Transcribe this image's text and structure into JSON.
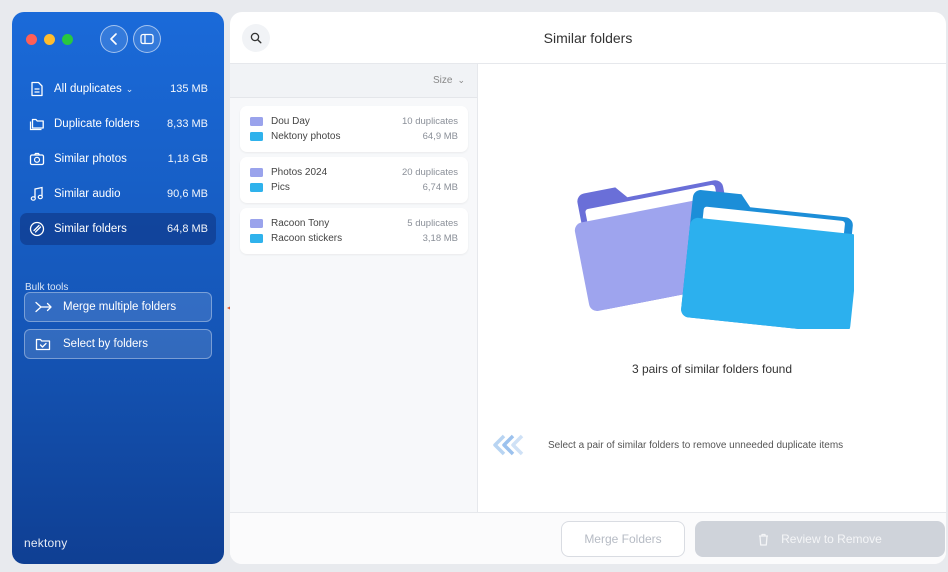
{
  "sidebar": {
    "items": [
      {
        "label": "All duplicates",
        "size": "135 MB",
        "icon": "document-icon",
        "has_dropdown": true
      },
      {
        "label": "Duplicate folders",
        "size": "8,33 MB",
        "icon": "folders-icon"
      },
      {
        "label": "Similar photos",
        "size": "1,18 GB",
        "icon": "camera-icon"
      },
      {
        "label": "Similar audio",
        "size": "90,6 MB",
        "icon": "music-note-icon"
      },
      {
        "label": "Similar folders",
        "size": "64,8 MB",
        "icon": "similar-folders-icon",
        "active": true
      }
    ],
    "chevron": "⌄",
    "bulk_title": "Bulk tools",
    "bulk_buttons": [
      {
        "label": "Merge multiple folders",
        "icon": "merge-arrow-icon"
      },
      {
        "label": "Select by folders",
        "icon": "select-checkbox-icon"
      }
    ],
    "logo": "nektony"
  },
  "header": {
    "title": "Similar folders"
  },
  "list": {
    "sort_label": "Size",
    "sort_chevron": "⌄",
    "pairs": [
      {
        "folder_a": "Dou Day",
        "folder_b": "Nektony photos",
        "duplicates": "10 duplicates",
        "size": "64,9 MB"
      },
      {
        "folder_a": "Photos 2024",
        "folder_b": "Pics",
        "duplicates": "20 duplicates",
        "size": "6,74 MB"
      },
      {
        "folder_a": "Racoon Tony",
        "folder_b": "Racoon stickers",
        "duplicates": "5 duplicates",
        "size": "3,18 MB"
      }
    ]
  },
  "detail": {
    "found_text": "3 pairs of similar folders found",
    "hint": "Select a pair of similar folders to remove unneeded duplicate items"
  },
  "footer": {
    "merge_label": "Merge Folders",
    "review_label": "Review to Remove"
  },
  "colors": {
    "sidebar_top": "#1a6ad9",
    "sidebar_bottom": "#0f3f93",
    "folder_purple": "#9aa3ec",
    "folder_blue": "#2fb2ec",
    "annotation_arrow": "#e0552a"
  }
}
